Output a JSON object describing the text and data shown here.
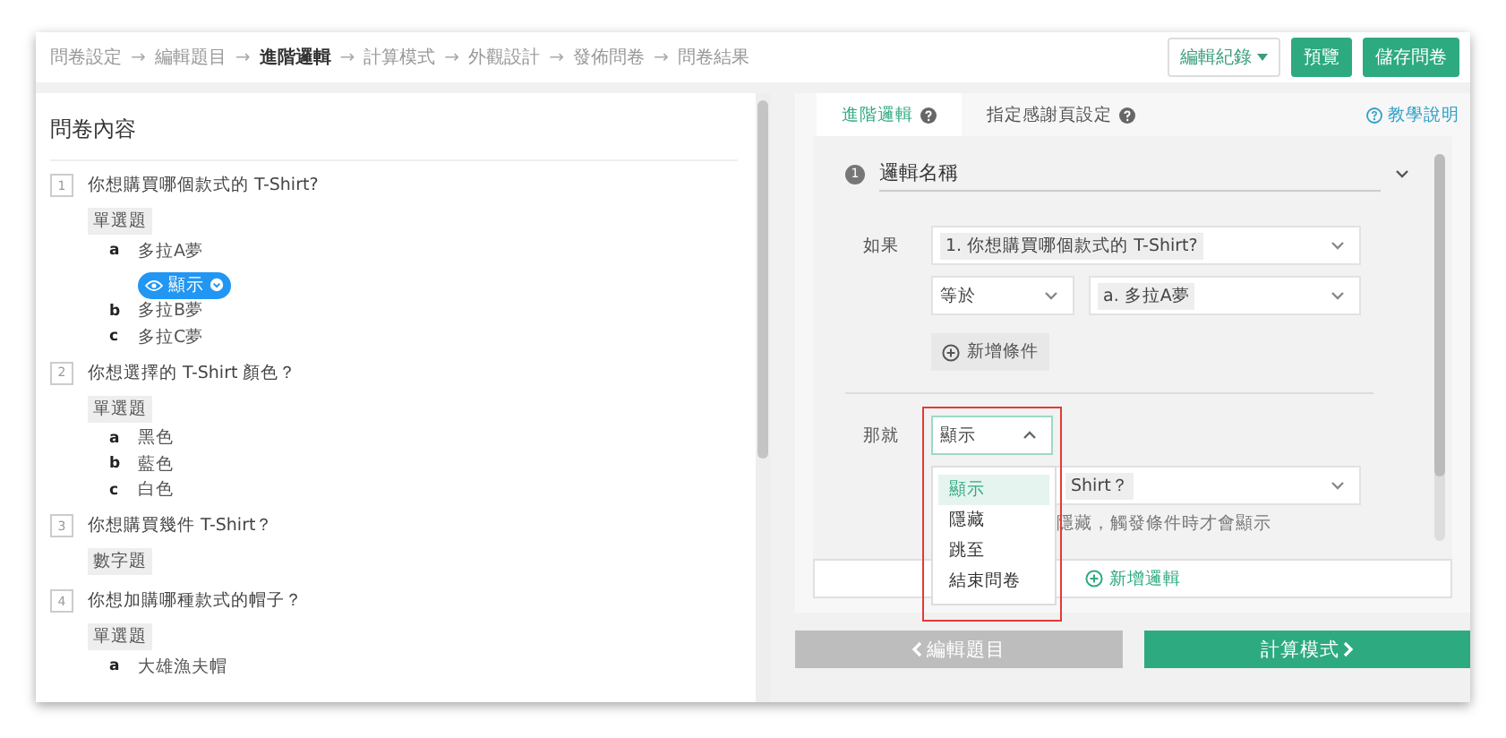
{
  "steps": [
    {
      "label": "問卷設定",
      "selected": false
    },
    {
      "label": "編輯題目",
      "selected": false
    },
    {
      "label": "進階邏輯",
      "selected": true
    },
    {
      "label": "計算模式",
      "selected": false
    },
    {
      "label": "外觀設計",
      "selected": false
    },
    {
      "label": "發佈問卷",
      "selected": false
    },
    {
      "label": "問卷結果",
      "selected": false
    }
  ],
  "step_separator": "→",
  "header_buttons": {
    "history": "編輯紀錄",
    "preview": "預覽",
    "save": "儲存問卷"
  },
  "questionnaire": {
    "title": "問卷內容",
    "questions": [
      {
        "number": "1",
        "text": "你想購買哪個款式的 T-Shirt?",
        "type": "單選題",
        "options": [
          {
            "letter": "a",
            "text": "多拉A夢",
            "badge": "顯示"
          },
          {
            "letter": "b",
            "text": "多拉B夢"
          },
          {
            "letter": "c",
            "text": "多拉C夢"
          }
        ]
      },
      {
        "number": "2",
        "text": "你想選擇的 T-Shirt 顏色？",
        "type": "單選題",
        "options": [
          {
            "letter": "a",
            "text": "黑色"
          },
          {
            "letter": "b",
            "text": "藍色"
          },
          {
            "letter": "c",
            "text": "白色"
          }
        ]
      },
      {
        "number": "3",
        "text": "你想購買幾件 T-Shirt？",
        "type": "數字題"
      },
      {
        "number": "4",
        "text": "你想加購哪種款式的帽子？",
        "type": "單選題",
        "options": [
          {
            "letter": "a",
            "text": "大雄漁夫帽"
          }
        ]
      }
    ]
  },
  "logic": {
    "tabs": [
      {
        "label": "進階邏輯",
        "selected": true
      },
      {
        "label": "指定感謝頁設定",
        "selected": false
      }
    ],
    "help_link": "教學說明",
    "rule": {
      "number": "1",
      "name": "邏輯名稱",
      "if_label": "如果",
      "question": "1. 你想購買哪個款式的 T-Shirt?",
      "operator": "等於",
      "answer": "a. 多拉A夢",
      "add_condition": "新增條件",
      "then_label": "那就",
      "action": {
        "value": "顯示",
        "expanded": true,
        "options": [
          {
            "label": "顯示",
            "selected": true
          },
          {
            "label": "隱藏",
            "selected": false
          },
          {
            "label": "跳至",
            "selected": false
          },
          {
            "label": "結束問卷",
            "selected": false
          }
        ]
      },
      "target": "Shirt？",
      "hint": "隱藏，觸發條件時才會顯示"
    },
    "add_logic": "新增邏輯"
  },
  "footer": {
    "back": "編輯題目",
    "next": "計算模式"
  }
}
